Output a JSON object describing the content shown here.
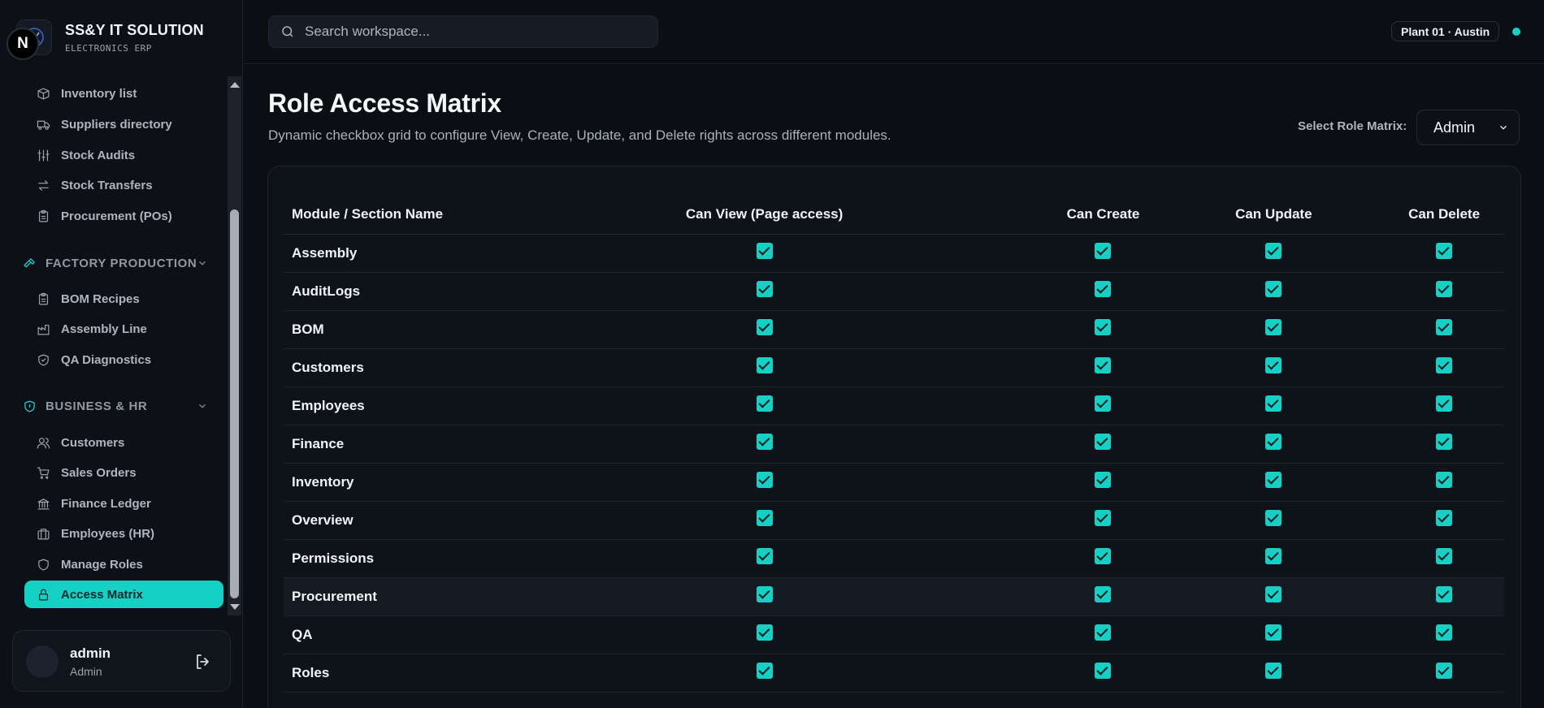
{
  "brand": {
    "name": "SS&Y IT SOLUTION",
    "subtitle": "ELECTRONICS ERP"
  },
  "nav": {
    "items_top": [
      {
        "label": "Inventory list",
        "icon": "package-icon"
      },
      {
        "label": "Suppliers directory",
        "icon": "truck-icon"
      },
      {
        "label": "Stock Audits",
        "icon": "sliders-icon"
      },
      {
        "label": "Stock Transfers",
        "icon": "transfer-icon"
      },
      {
        "label": "Procurement (POs)",
        "icon": "clipboard-icon"
      }
    ],
    "section_factory": {
      "label": "FACTORY PRODUCTION",
      "icon": "hammer-icon"
    },
    "items_factory": [
      {
        "label": "BOM Recipes",
        "icon": "clipboard-icon"
      },
      {
        "label": "Assembly Line",
        "icon": "factory-icon"
      },
      {
        "label": "QA Diagnostics",
        "icon": "shield-check-icon"
      }
    ],
    "section_business": {
      "label": "BUSINESS & HR",
      "icon": "shield-icon"
    },
    "items_business": [
      {
        "label": "Customers",
        "icon": "users-icon"
      },
      {
        "label": "Sales Orders",
        "icon": "cart-icon"
      },
      {
        "label": "Finance Ledger",
        "icon": "bank-icon"
      },
      {
        "label": "Employees (HR)",
        "icon": "briefcase-icon"
      },
      {
        "label": "Manage Roles",
        "icon": "shield-icon"
      },
      {
        "label": "Access Matrix",
        "icon": "lock-icon",
        "active": true
      }
    ]
  },
  "user": {
    "name": "admin",
    "role": "Admin",
    "badge": "N"
  },
  "topbar": {
    "search_placeholder": "Search workspace...",
    "plant": "Plant 01 · Austin",
    "status_color": "#16d0c6"
  },
  "page": {
    "title": "Role Access Matrix",
    "description": "Dynamic checkbox grid to configure View, Create, Update, and Delete rights across different modules.",
    "role_label": "Select Role Matrix:",
    "role_value": "Admin"
  },
  "matrix": {
    "headers": [
      "Module / Section Name",
      "Can View (Page access)",
      "Can Create",
      "Can Update",
      "Can Delete"
    ],
    "rows": [
      {
        "module": "Assembly",
        "view": true,
        "create": true,
        "update": true,
        "delete": true
      },
      {
        "module": "AuditLogs",
        "view": true,
        "create": true,
        "update": true,
        "delete": true
      },
      {
        "module": "BOM",
        "view": true,
        "create": true,
        "update": true,
        "delete": true
      },
      {
        "module": "Customers",
        "view": true,
        "create": true,
        "update": true,
        "delete": true
      },
      {
        "module": "Employees",
        "view": true,
        "create": true,
        "update": true,
        "delete": true
      },
      {
        "module": "Finance",
        "view": true,
        "create": true,
        "update": true,
        "delete": true
      },
      {
        "module": "Inventory",
        "view": true,
        "create": true,
        "update": true,
        "delete": true
      },
      {
        "module": "Overview",
        "view": true,
        "create": true,
        "update": true,
        "delete": true
      },
      {
        "module": "Permissions",
        "view": true,
        "create": true,
        "update": true,
        "delete": true
      },
      {
        "module": "Procurement",
        "view": true,
        "create": true,
        "update": true,
        "delete": true
      },
      {
        "module": "QA",
        "view": true,
        "create": true,
        "update": true,
        "delete": true
      },
      {
        "module": "Roles",
        "view": true,
        "create": true,
        "update": true,
        "delete": true
      }
    ]
  },
  "colors": {
    "accent": "#16d0c6",
    "background": "#0b0e13"
  }
}
